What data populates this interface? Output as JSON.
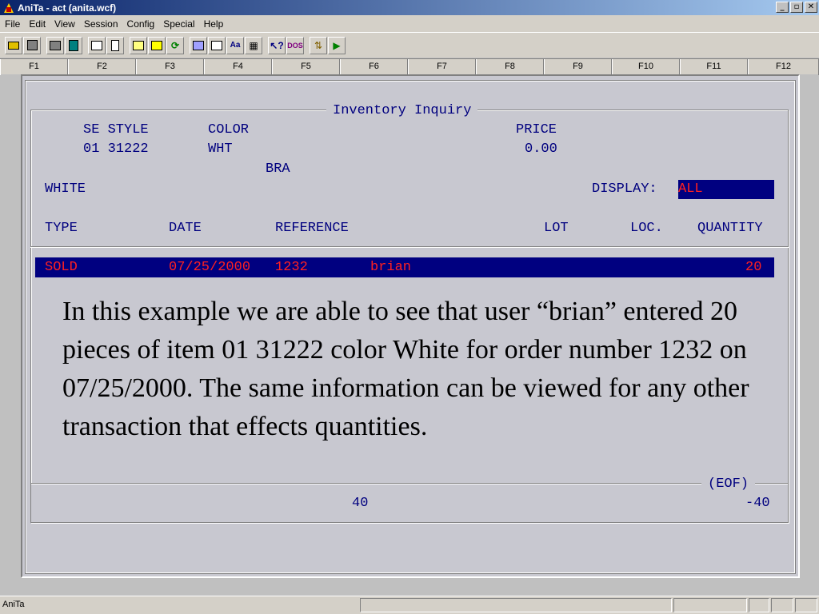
{
  "window": {
    "title": "AniTa -  act (anita.wcf)",
    "min": "_",
    "max": "▫",
    "close": "✕"
  },
  "menu": [
    "File",
    "Edit",
    "View",
    "Session",
    "Config",
    "Special",
    "Help"
  ],
  "toolbar_icons": [
    "open-folder-icon",
    "save-icon",
    "copy-icon",
    "paste-icon",
    "print-icon",
    "print-preview-icon",
    "screen-icon",
    "frame-icon",
    "refresh-icon",
    "monitor-icon",
    "form-icon",
    "font-icon",
    "keyboard-icon",
    "help-cursor-icon",
    "dos-icon",
    "transfer-icon",
    "run-icon"
  ],
  "fkeys": [
    "F1",
    "F2",
    "F3",
    "F4",
    "F5",
    "F6",
    "F7",
    "F8",
    "F9",
    "F10",
    "F11",
    "F12"
  ],
  "screen": {
    "title": "Inventory Inquiry",
    "h_se_style": "SE STYLE",
    "h_color": "COLOR",
    "h_price": "PRICE",
    "v_se_style": "01 31222",
    "v_color": "WHT",
    "v_price": "0.00",
    "v_desc": "BRA",
    "v_color_name": "WHITE",
    "display_label": "DISPLAY:",
    "display_value": "ALL",
    "col_type": "TYPE",
    "col_date": "DATE",
    "col_reference": "REFERENCE",
    "col_lot": "LOT",
    "col_loc": "LOC.",
    "col_quantity": "QUANTITY",
    "row": {
      "type": "SOLD",
      "date": "07/25/2000",
      "reference": "1232",
      "user": "brian",
      "quantity": "20"
    },
    "eof": "(EOF)",
    "total_left": "40",
    "total_right": "-40"
  },
  "caption": "In this example we are able to see that user “brian” entered 20 pieces of item 01 31222 color White for order number 1232 on 07/25/2000. The same information can be viewed for any other transaction that effects quantities.",
  "status": {
    "app": "AniTa"
  }
}
